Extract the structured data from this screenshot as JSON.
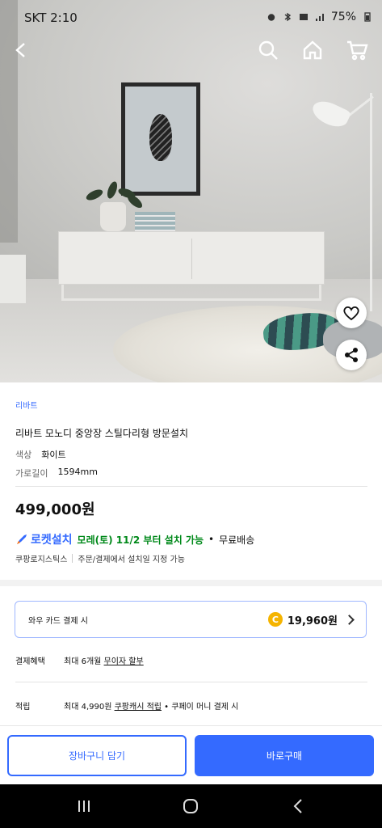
{
  "status_bar": {
    "carrier": "SKT 2:10",
    "battery": "75%"
  },
  "nav": {
    "back_icon": "chevron-left-icon",
    "search_icon": "search-icon",
    "home_icon": "home-icon",
    "cart_icon": "cart-icon"
  },
  "product": {
    "brand": "리바트",
    "title": "리바트 모노디 중앙장 스틸다리형 방문설치",
    "options": [
      {
        "label": "색상",
        "value": "화이트"
      },
      {
        "label": "가로길이",
        "value": "1594mm"
      }
    ],
    "price": "499,000원"
  },
  "delivery": {
    "rocket_label": "로켓설치",
    "date_text": "모레(토) 11/2 부터 설치 가능",
    "separator": "•",
    "free_shipping": "무료배송",
    "logistics": "쿠팡로지스틱스",
    "install_note": "주문/결제에서 설치일 지정 가능"
  },
  "card_offer": {
    "label": "와우 카드 결제 시",
    "coin_symbol": "C",
    "amount": "19,960원"
  },
  "benefits": [
    {
      "label": "결제혜택",
      "text": "최대 6개월 ",
      "link": "무이자 할부",
      "suffix": ""
    },
    {
      "label": "적립",
      "text": "최대 4,990원 ",
      "link": "쿠팡캐시 적립",
      "suffix": " • 쿠페이 머니 결제 시"
    }
  ],
  "actions": {
    "add_to_cart": "장바구니 담기",
    "buy_now": "바로구매"
  },
  "colors": {
    "accent": "#346aff",
    "rocket_green": "#00891a",
    "coin": "#f5b400"
  }
}
